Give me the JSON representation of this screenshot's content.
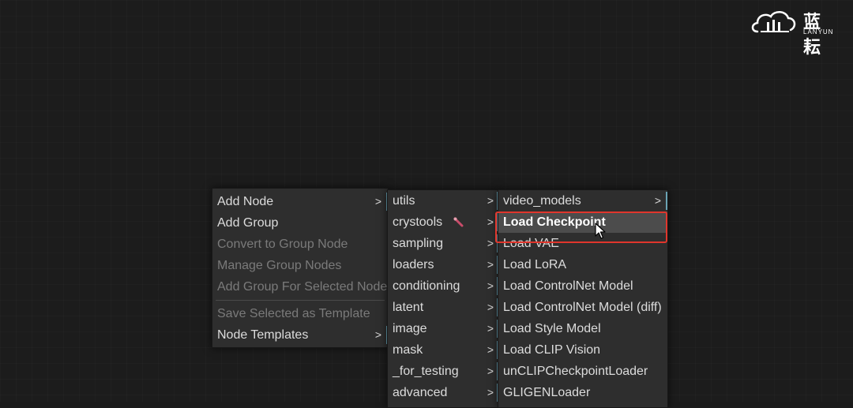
{
  "brand": {
    "name_cn": "蓝耘",
    "name_en": "LANYUN",
    "logo_icon": "cloud-logo-icon"
  },
  "context_menu": {
    "items": [
      {
        "label": "Add Node",
        "has_submenu": true,
        "enabled": true
      },
      {
        "label": "Add Group",
        "has_submenu": false,
        "enabled": true
      },
      {
        "label": "Convert to Group Node",
        "has_submenu": false,
        "enabled": false
      },
      {
        "label": "Manage Group Nodes",
        "has_submenu": false,
        "enabled": false
      },
      {
        "label": "Add Group For Selected Nodes",
        "has_submenu": false,
        "enabled": false
      },
      {
        "label": "Save Selected as Template",
        "has_submenu": false,
        "enabled": false
      },
      {
        "label": "Node Templates",
        "has_submenu": true,
        "enabled": true
      }
    ],
    "arrow": ">"
  },
  "node_categories": {
    "items": [
      {
        "label": "utils"
      },
      {
        "label": "crystools",
        "icon": "wrench-icon"
      },
      {
        "label": "sampling"
      },
      {
        "label": "loaders"
      },
      {
        "label": "conditioning"
      },
      {
        "label": "latent"
      },
      {
        "label": "image"
      },
      {
        "label": "mask"
      },
      {
        "label": "_for_testing"
      },
      {
        "label": "advanced"
      }
    ],
    "arrow": ">"
  },
  "loaders_menu": {
    "items": [
      {
        "label": "video_models",
        "has_submenu": true
      },
      {
        "label": "Load Checkpoint",
        "highlighted": true
      },
      {
        "label": "Load VAE"
      },
      {
        "label": "Load LoRA"
      },
      {
        "label": "Load ControlNet Model"
      },
      {
        "label": "Load ControlNet Model (diff)"
      },
      {
        "label": "Load Style Model"
      },
      {
        "label": "Load CLIP Vision"
      },
      {
        "label": "unCLIPCheckpointLoader"
      },
      {
        "label": "GLIGENLoader"
      }
    ],
    "arrow": ">"
  },
  "colors": {
    "canvas_bg": "#1c1c1c",
    "menu_bg": "#2e2e2e",
    "submenu_marker": "#6aa3b4",
    "highlight_border": "#e0362c"
  }
}
